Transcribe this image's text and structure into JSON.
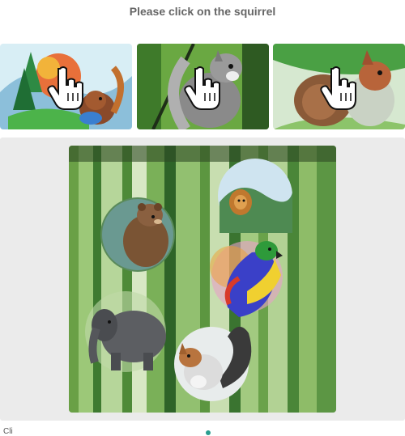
{
  "challenge": {
    "prompt": "Please click on the squirrel"
  },
  "examples": [
    {
      "animal": "squirrel",
      "style": "colorful painting",
      "icon": "hand-pointer-icon"
    },
    {
      "animal": "squirrel",
      "style": "gray squirrel",
      "icon": "hand-pointer-icon"
    },
    {
      "animal": "squirrel",
      "style": "watercolor",
      "icon": "hand-pointer-icon"
    }
  ],
  "scene": {
    "background": "green watercolor forest",
    "animals": [
      "bear",
      "lion",
      "parrot",
      "elephant",
      "squirrel"
    ],
    "target": "squirrel"
  },
  "footer": {
    "text": "Cli"
  }
}
